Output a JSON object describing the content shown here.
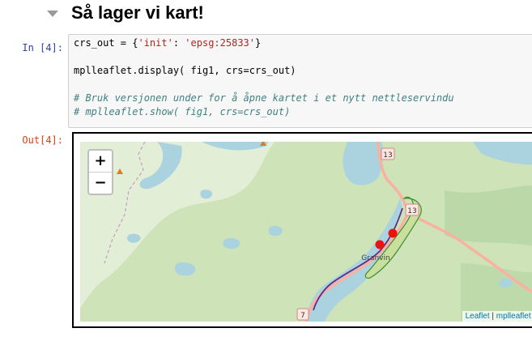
{
  "heading": {
    "title": "Så lager vi kart!"
  },
  "input_cell": {
    "prompt": "In [4]:",
    "code_lines": [
      {
        "pre": "crs_out = {",
        "str1": "'init'",
        "mid": ": ",
        "str2": "'epsg:25833'",
        "post": "}"
      },
      {
        "text": ""
      },
      {
        "text": "mplleaflet.display( fig1, crs=crs_out)"
      },
      {
        "text": ""
      },
      {
        "comment": "# Bruk versjonen under for å åpne kartet i et nytt nettleservindu"
      },
      {
        "comment": "# mplleaflet.show( fig1, crs=crs_out)"
      }
    ]
  },
  "output_cell": {
    "prompt": "Out[4]:",
    "map": {
      "zoom_in": "+",
      "zoom_out": "−",
      "place_label": "Granvin",
      "road_shields": [
        "13",
        "13",
        "7"
      ],
      "attribution": {
        "link1": "Leaflet",
        "sep": " | ",
        "link2": "mplleaflet",
        "tail": " |"
      },
      "colors": {
        "water": "#aad3df",
        "land": "#cfe3b9",
        "forest": "#add19e",
        "road": "#f9b2a0",
        "route": "#5b2d8e",
        "marker": "#ee1111"
      }
    }
  }
}
